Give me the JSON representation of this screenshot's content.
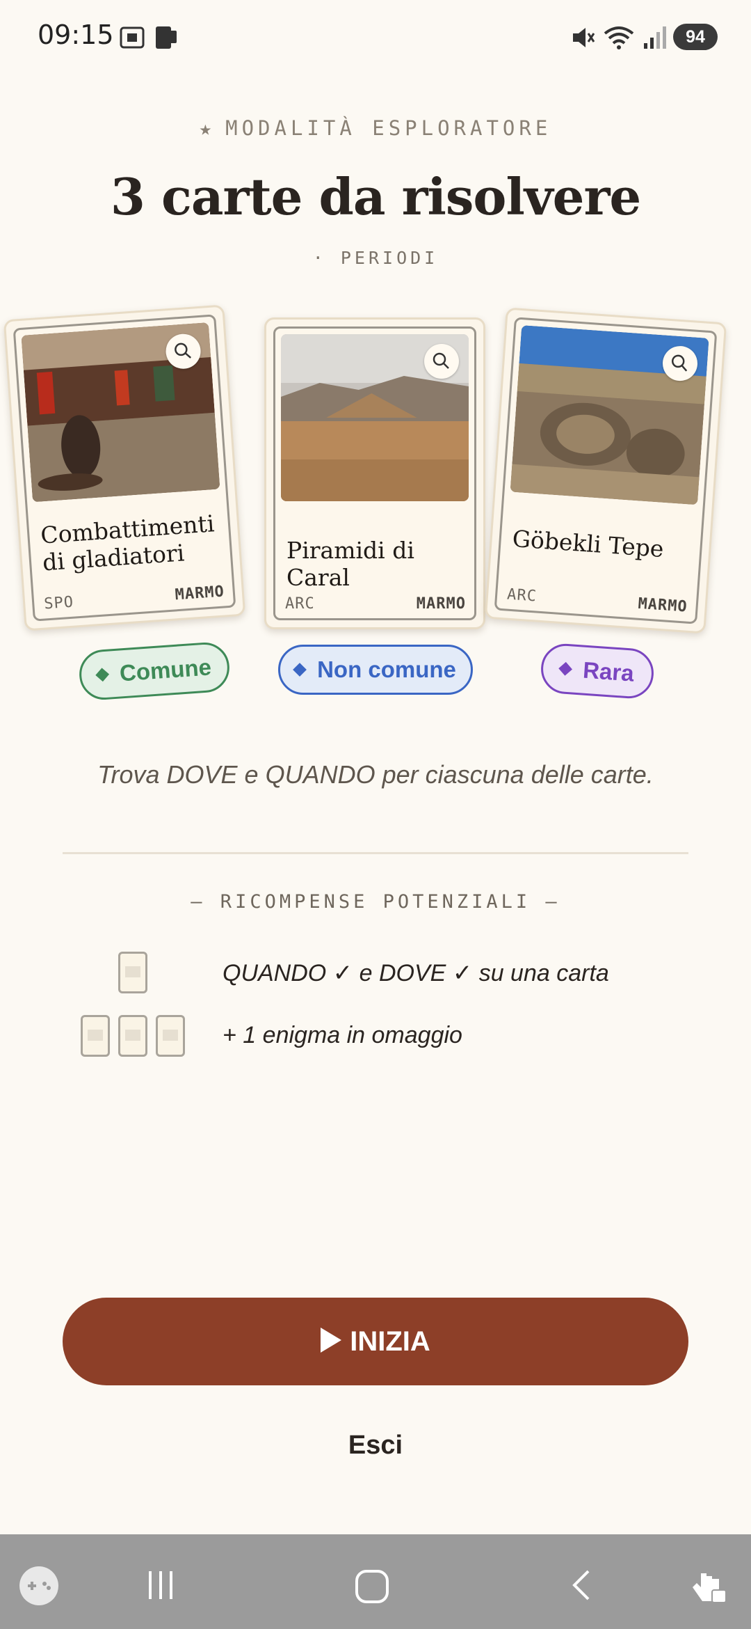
{
  "status_bar": {
    "time": "09:15",
    "battery": "94"
  },
  "header": {
    "mode_star": "★",
    "mode_label": "MODALITÀ ESPLORATORE",
    "title": "3 carte da risolvere",
    "subtitle": "· PERIODI"
  },
  "cards": [
    {
      "name": "Combattimenti di gladiatori",
      "code": "SPO",
      "material": "MARMO",
      "rarity": "Comune",
      "rarity_color": "#3e8a57"
    },
    {
      "name": "Piramidi di Caral",
      "code": "ARC",
      "material": "MARMO",
      "rarity": "Non comune",
      "rarity_color": "#3a66c4"
    },
    {
      "name": "Göbekli Tepe",
      "code": "ARC",
      "material": "MARMO",
      "rarity": "Rara",
      "rarity_color": "#7a45c0"
    }
  ],
  "instruction": "Trova DOVE e QUANDO per ciascuna delle carte.",
  "rewards": {
    "title": "— RICOMPENSE POTENZIALI —",
    "items": [
      {
        "text": "QUANDO ✓ e DOVE ✓ su una carta"
      },
      {
        "text": "+ 1 enigma in omaggio"
      }
    ]
  },
  "actions": {
    "start_label": "INIZIA",
    "exit_label": "Esci"
  },
  "icons": [
    "screenshot-icon",
    "phone-icon",
    "mute-icon",
    "wifi-icon",
    "signal-icon",
    "zoom-icon",
    "game-icon",
    "recent-apps-icon",
    "home-icon",
    "back-icon",
    "touch-lock-icon"
  ]
}
